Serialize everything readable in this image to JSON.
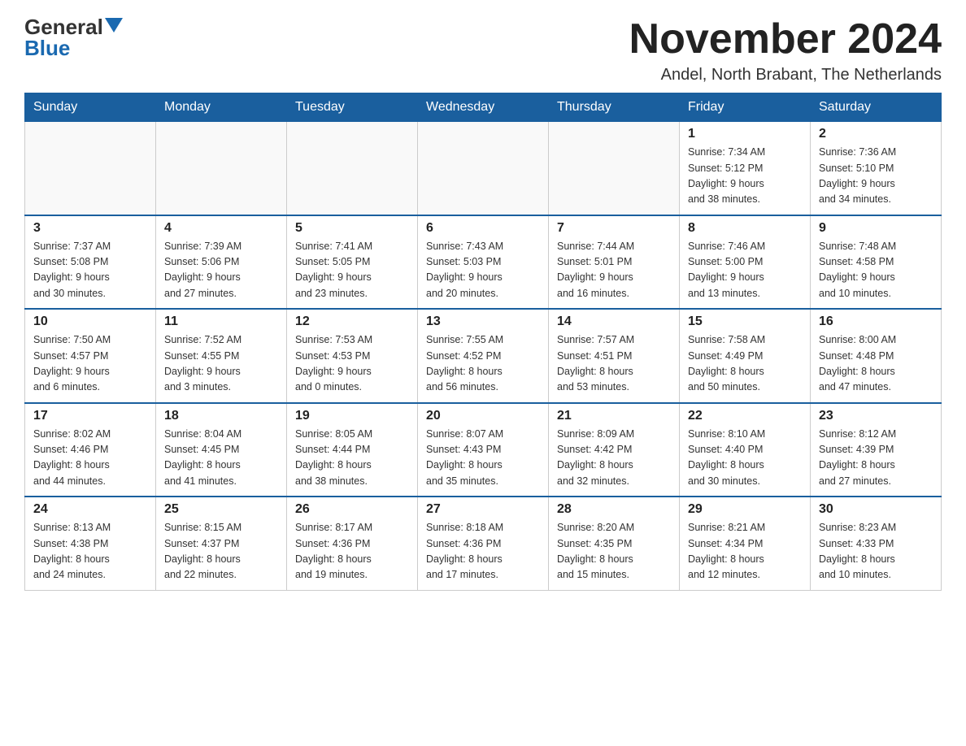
{
  "header": {
    "logo_general": "General",
    "logo_blue": "Blue",
    "month_title": "November 2024",
    "location": "Andel, North Brabant, The Netherlands"
  },
  "weekdays": [
    "Sunday",
    "Monday",
    "Tuesday",
    "Wednesday",
    "Thursday",
    "Friday",
    "Saturday"
  ],
  "weeks": [
    [
      {
        "day": "",
        "info": ""
      },
      {
        "day": "",
        "info": ""
      },
      {
        "day": "",
        "info": ""
      },
      {
        "day": "",
        "info": ""
      },
      {
        "day": "",
        "info": ""
      },
      {
        "day": "1",
        "info": "Sunrise: 7:34 AM\nSunset: 5:12 PM\nDaylight: 9 hours\nand 38 minutes."
      },
      {
        "day": "2",
        "info": "Sunrise: 7:36 AM\nSunset: 5:10 PM\nDaylight: 9 hours\nand 34 minutes."
      }
    ],
    [
      {
        "day": "3",
        "info": "Sunrise: 7:37 AM\nSunset: 5:08 PM\nDaylight: 9 hours\nand 30 minutes."
      },
      {
        "day": "4",
        "info": "Sunrise: 7:39 AM\nSunset: 5:06 PM\nDaylight: 9 hours\nand 27 minutes."
      },
      {
        "day": "5",
        "info": "Sunrise: 7:41 AM\nSunset: 5:05 PM\nDaylight: 9 hours\nand 23 minutes."
      },
      {
        "day": "6",
        "info": "Sunrise: 7:43 AM\nSunset: 5:03 PM\nDaylight: 9 hours\nand 20 minutes."
      },
      {
        "day": "7",
        "info": "Sunrise: 7:44 AM\nSunset: 5:01 PM\nDaylight: 9 hours\nand 16 minutes."
      },
      {
        "day": "8",
        "info": "Sunrise: 7:46 AM\nSunset: 5:00 PM\nDaylight: 9 hours\nand 13 minutes."
      },
      {
        "day": "9",
        "info": "Sunrise: 7:48 AM\nSunset: 4:58 PM\nDaylight: 9 hours\nand 10 minutes."
      }
    ],
    [
      {
        "day": "10",
        "info": "Sunrise: 7:50 AM\nSunset: 4:57 PM\nDaylight: 9 hours\nand 6 minutes."
      },
      {
        "day": "11",
        "info": "Sunrise: 7:52 AM\nSunset: 4:55 PM\nDaylight: 9 hours\nand 3 minutes."
      },
      {
        "day": "12",
        "info": "Sunrise: 7:53 AM\nSunset: 4:53 PM\nDaylight: 9 hours\nand 0 minutes."
      },
      {
        "day": "13",
        "info": "Sunrise: 7:55 AM\nSunset: 4:52 PM\nDaylight: 8 hours\nand 56 minutes."
      },
      {
        "day": "14",
        "info": "Sunrise: 7:57 AM\nSunset: 4:51 PM\nDaylight: 8 hours\nand 53 minutes."
      },
      {
        "day": "15",
        "info": "Sunrise: 7:58 AM\nSunset: 4:49 PM\nDaylight: 8 hours\nand 50 minutes."
      },
      {
        "day": "16",
        "info": "Sunrise: 8:00 AM\nSunset: 4:48 PM\nDaylight: 8 hours\nand 47 minutes."
      }
    ],
    [
      {
        "day": "17",
        "info": "Sunrise: 8:02 AM\nSunset: 4:46 PM\nDaylight: 8 hours\nand 44 minutes."
      },
      {
        "day": "18",
        "info": "Sunrise: 8:04 AM\nSunset: 4:45 PM\nDaylight: 8 hours\nand 41 minutes."
      },
      {
        "day": "19",
        "info": "Sunrise: 8:05 AM\nSunset: 4:44 PM\nDaylight: 8 hours\nand 38 minutes."
      },
      {
        "day": "20",
        "info": "Sunrise: 8:07 AM\nSunset: 4:43 PM\nDaylight: 8 hours\nand 35 minutes."
      },
      {
        "day": "21",
        "info": "Sunrise: 8:09 AM\nSunset: 4:42 PM\nDaylight: 8 hours\nand 32 minutes."
      },
      {
        "day": "22",
        "info": "Sunrise: 8:10 AM\nSunset: 4:40 PM\nDaylight: 8 hours\nand 30 minutes."
      },
      {
        "day": "23",
        "info": "Sunrise: 8:12 AM\nSunset: 4:39 PM\nDaylight: 8 hours\nand 27 minutes."
      }
    ],
    [
      {
        "day": "24",
        "info": "Sunrise: 8:13 AM\nSunset: 4:38 PM\nDaylight: 8 hours\nand 24 minutes."
      },
      {
        "day": "25",
        "info": "Sunrise: 8:15 AM\nSunset: 4:37 PM\nDaylight: 8 hours\nand 22 minutes."
      },
      {
        "day": "26",
        "info": "Sunrise: 8:17 AM\nSunset: 4:36 PM\nDaylight: 8 hours\nand 19 minutes."
      },
      {
        "day": "27",
        "info": "Sunrise: 8:18 AM\nSunset: 4:36 PM\nDaylight: 8 hours\nand 17 minutes."
      },
      {
        "day": "28",
        "info": "Sunrise: 8:20 AM\nSunset: 4:35 PM\nDaylight: 8 hours\nand 15 minutes."
      },
      {
        "day": "29",
        "info": "Sunrise: 8:21 AM\nSunset: 4:34 PM\nDaylight: 8 hours\nand 12 minutes."
      },
      {
        "day": "30",
        "info": "Sunrise: 8:23 AM\nSunset: 4:33 PM\nDaylight: 8 hours\nand 10 minutes."
      }
    ]
  ]
}
